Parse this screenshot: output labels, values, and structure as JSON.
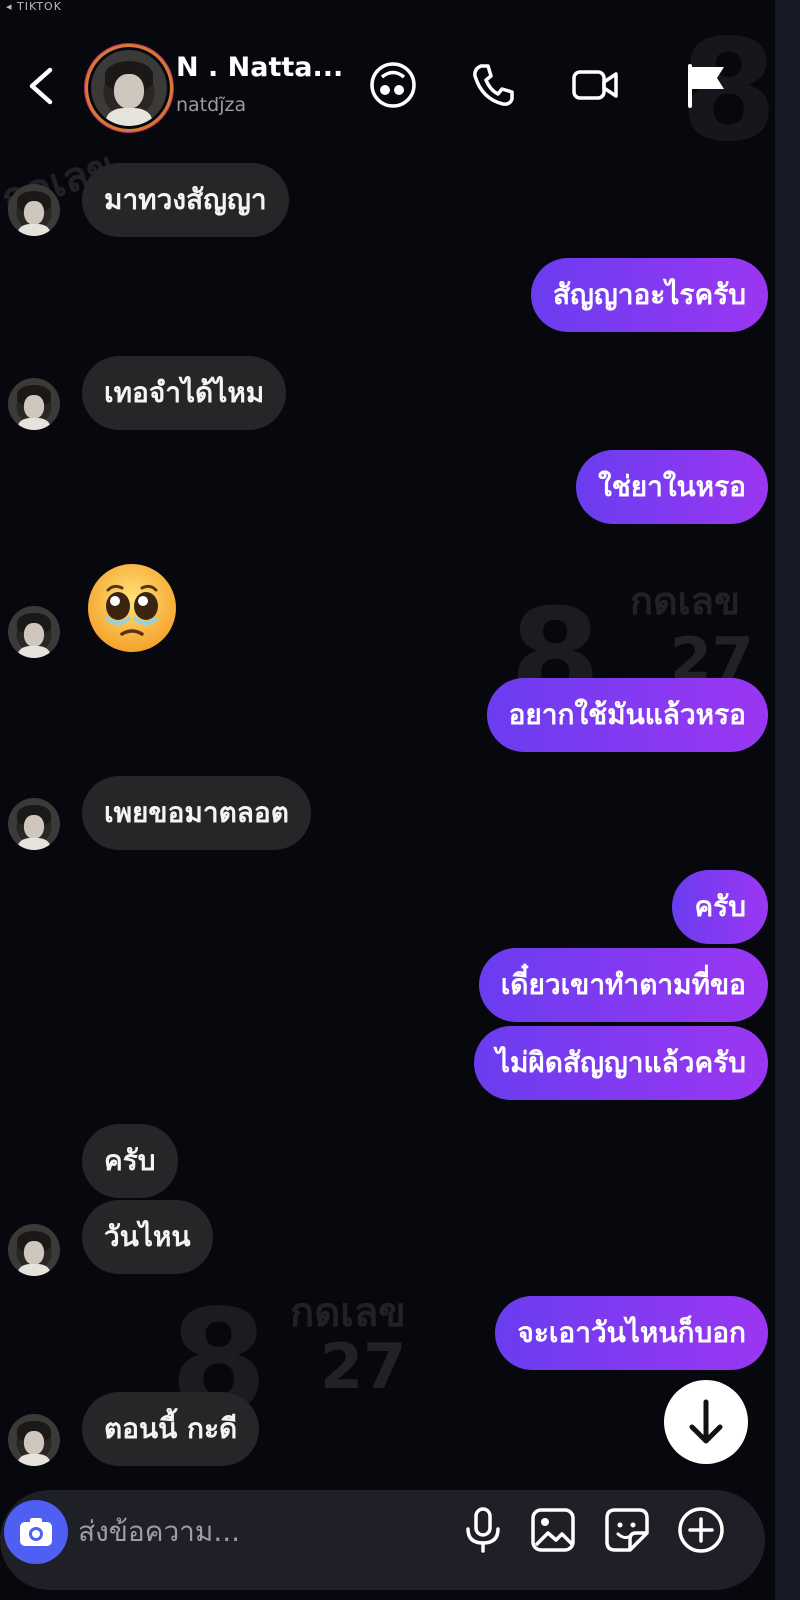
{
  "status_bar": {
    "text": "◂ TIKTOK"
  },
  "header": {
    "name": "N . Natta...",
    "handle": "natdj̃za",
    "icons": [
      "back-chevron",
      "anonymous-mode",
      "phone",
      "video",
      "flag"
    ]
  },
  "messages": [
    {
      "side": "in",
      "text": "มาทวงสัญญา"
    },
    {
      "side": "out",
      "text": "สัญญาอะไรครับ"
    },
    {
      "side": "in",
      "text": "เทอจำได้ไหม"
    },
    {
      "side": "out",
      "text": "ใช่ยาในหรอ"
    },
    {
      "side": "in",
      "emoji": "pleading-face"
    },
    {
      "side": "out",
      "text": "อยากใช้มันแล้วหรอ"
    },
    {
      "side": "in",
      "text": "เพยขอมาตลอต"
    },
    {
      "side": "out",
      "text": "ครับ"
    },
    {
      "side": "out",
      "text": "เดี๋ยวเขาทำตามที่ขอ"
    },
    {
      "side": "out",
      "text": "ไม่ผิดสัญญาแล้วครับ"
    },
    {
      "side": "in",
      "text": "ครับ"
    },
    {
      "side": "in",
      "text": "วันไหน"
    },
    {
      "side": "out",
      "text": "จะเอาวันไหนก็บอก"
    },
    {
      "side": "in",
      "text": "ตอนนี้ กะดี"
    }
  ],
  "composer": {
    "placeholder": "ส่งข้อความ...",
    "icons": [
      "camera",
      "microphone",
      "gallery",
      "sticker",
      "add"
    ]
  },
  "watermark": {
    "brand": "กดเลข",
    "number": "27",
    "digit": "8"
  },
  "colors": {
    "background": "#07080d",
    "incoming": "#262629",
    "outgoing_start": "#6a3df0",
    "outgoing_end": "#9b36f2",
    "camera": "#4f5ef3"
  }
}
